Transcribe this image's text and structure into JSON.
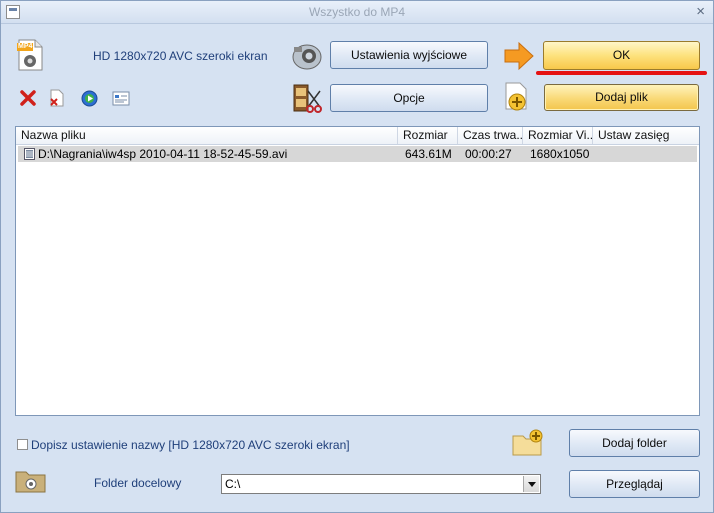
{
  "window": {
    "title": "Wszystko do MP4",
    "close_glyph": "×"
  },
  "profile": {
    "label": "HD 1280x720 AVC szeroki ekran",
    "icon": "mp4-file-icon",
    "badge": "MP4"
  },
  "buttons": {
    "output_settings": "Ustawienia wyjściowe",
    "ok": "OK",
    "options": "Opcje",
    "add_file": "Dodaj plik",
    "add_folder": "Dodaj folder",
    "browse": "Przeglądaj"
  },
  "toolbar_icons": [
    "delete-icon",
    "remove-file-icon",
    "play-icon",
    "info-icon"
  ],
  "table": {
    "columns": [
      "Nazwa pliku",
      "Rozmiar",
      "Czas trwa...",
      "Rozmiar Vi...",
      "Ustaw zasięg"
    ],
    "rows": [
      {
        "name": "D:\\Nagrania\\iw4sp 2010-04-11 18-52-45-59.avi",
        "size": "643.61M",
        "duration": "00:00:27",
        "video_size": "1680x1050",
        "range": ""
      }
    ]
  },
  "append_name": {
    "label": "Dopisz ustawienie nazwy [HD 1280x720 AVC szeroki ekran]",
    "checked": false
  },
  "output_folder": {
    "label": "Folder docelowy",
    "value": "C:\\"
  },
  "colors": {
    "accent_red": "#e51212",
    "ok_gold": "#f8c84a",
    "window_bg": "#d6e2f2"
  }
}
